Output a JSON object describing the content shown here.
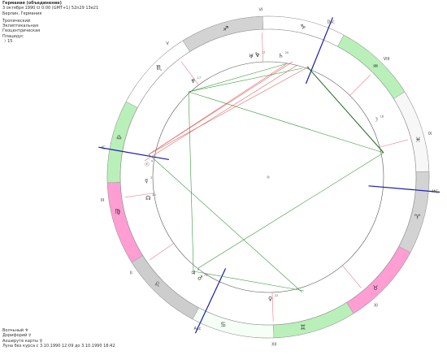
{
  "header": {
    "title": "Германия (объединение)",
    "line1": "3 октября 1990  ☋  0:00 (GMT+1) 52n29  13e21",
    "line2": "Берлин, Германия",
    "line3": "Тропический",
    "line4": "Эклиптикальная",
    "line5": "Геоцентрическая",
    "line6": "Плацидус",
    "line7": "☽  15"
  },
  "footer": {
    "line1": "Волчьный  ♆",
    "line2": "Дорифорий  ☿",
    "line3": "Ахшеруте карты  ♀",
    "line4": "Луна без курса с 3.10.1990 12:09 до 3.10.1990 18:42"
  },
  "houses": [
    {
      "label": "VI",
      "angle": 92.5
    },
    {
      "label": "Dsc",
      "angle": 68
    },
    {
      "label": "VIII",
      "angle": 45
    },
    {
      "label": "IX",
      "angle": 15
    },
    {
      "label": "MC",
      "angle": -5
    },
    {
      "label": "XI",
      "angle": -50
    },
    {
      "label": "XII",
      "angle": -88
    },
    {
      "label": "Asc",
      "angle": -115
    },
    {
      "label": "II",
      "angle": -145
    },
    {
      "label": "III",
      "angle": -172
    },
    {
      "label": "IC",
      "angle": 170
    },
    {
      "label": "V",
      "angle": 127
    }
  ],
  "signs": [
    {
      "glyph": "♑",
      "angle": 77
    },
    {
      "glyph": "♒",
      "angle": 46
    },
    {
      "glyph": "♓",
      "angle": 14
    },
    {
      "glyph": "♈",
      "angle": -15
    },
    {
      "glyph": "♉",
      "angle": -46
    },
    {
      "glyph": "♊",
      "angle": -77
    },
    {
      "glyph": "♋",
      "angle": -107
    },
    {
      "glyph": "♌",
      "angle": -136
    },
    {
      "glyph": "♍",
      "angle": -167
    },
    {
      "glyph": "♎",
      "angle": 165
    },
    {
      "glyph": "♏",
      "angle": 135
    },
    {
      "glyph": "♐",
      "angle": 106
    }
  ],
  "planets": [
    {
      "glyph": "♅",
      "deg": "6",
      "angle": 98
    },
    {
      "glyph": "♆",
      "deg": "12",
      "angle": 95
    },
    {
      "glyph": "♄",
      "deg": "20",
      "angle": 84
    },
    {
      "glyph": "♆",
      "deg": "17",
      "angle": 128
    },
    {
      "glyph": "☽",
      "deg": "18",
      "angle": 28
    },
    {
      "glyph": "☉",
      "deg": "9",
      "angle": 174
    },
    {
      "glyph": "☿",
      "deg": "2",
      "angle": 182
    },
    {
      "glyph": "☊",
      "deg": "20",
      "angle": 190
    },
    {
      "glyph": "♃",
      "deg": "5",
      "angle": 232
    },
    {
      "glyph": "♂",
      "deg": "22",
      "angle": 236
    },
    {
      "glyph": "♀",
      "deg": "22",
      "angle": 271
    }
  ]
}
